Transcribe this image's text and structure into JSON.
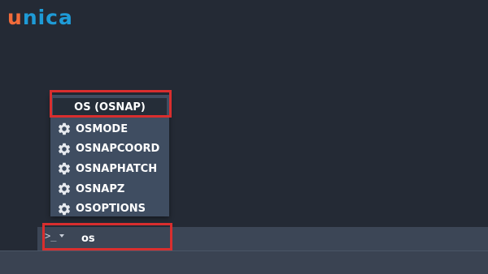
{
  "brand": {
    "logo_first": "u",
    "logo_rest": "nica",
    "colors": {
      "orange": "#f26b3a",
      "blue": "#1e9bd7"
    }
  },
  "autocomplete": {
    "header": "OS (OSNAP)",
    "items": [
      {
        "label": "OSMODE",
        "icon": "gear-icon"
      },
      {
        "label": "OSNAPCOORD",
        "icon": "gear-icon"
      },
      {
        "label": "OSNAPHATCH",
        "icon": "gear-icon"
      },
      {
        "label": "OSNAPZ",
        "icon": "gear-icon"
      },
      {
        "label": "OSOPTIONS",
        "icon": "gear-icon"
      }
    ]
  },
  "command_line": {
    "prompt": ">_",
    "value": "os",
    "dropdown_icon": "chevron-down-icon"
  },
  "highlight_color": "#d92e2e"
}
